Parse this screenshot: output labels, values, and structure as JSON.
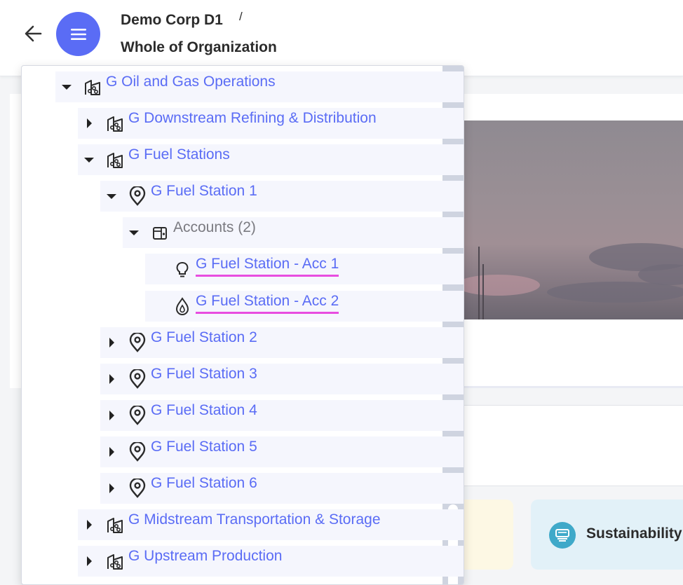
{
  "header": {
    "org_name": "Demo Corp D1",
    "separator": "/",
    "scope": "Whole of Organization"
  },
  "icons": {
    "back": "arrow-left-icon",
    "menu": "hamburger-menu-icon",
    "group": "building-group-icon",
    "site": "location-pin-icon",
    "accounts": "accounts-folder-icon",
    "electricity": "lightbulb-icon",
    "gas": "flame-drop-icon",
    "sustainability": "screen-stack-icon"
  },
  "colors": {
    "accent": "#5a6cf5",
    "link": "#5a6cf5",
    "highlight_underline": "#e84de0",
    "row_bg": "#f5f6fd"
  },
  "tree": [
    {
      "label": "G Oil and Gas Operations",
      "type": "group",
      "expanded": true
    },
    {
      "label": "G Downstream Refining & Distribution",
      "type": "group",
      "expanded": false
    },
    {
      "label": "G Fuel Stations",
      "type": "group",
      "expanded": true
    },
    {
      "label": "G Fuel Station 1",
      "type": "site",
      "expanded": true
    },
    {
      "label": "Accounts (2)",
      "type": "accounts",
      "expanded": true
    },
    {
      "label": "G Fuel Station - Acc 1",
      "type": "electricity"
    },
    {
      "label": "G Fuel Station - Acc 2",
      "type": "gas"
    },
    {
      "label": "G Fuel Station 2",
      "type": "site",
      "expanded": false
    },
    {
      "label": "G Fuel Station 3",
      "type": "site",
      "expanded": false
    },
    {
      "label": "G Fuel Station 4",
      "type": "site",
      "expanded": false
    },
    {
      "label": "G Fuel Station 5",
      "type": "site",
      "expanded": false
    },
    {
      "label": "G Fuel Station 6",
      "type": "site",
      "expanded": false
    },
    {
      "label": "G Midstream Transportation & Storage",
      "type": "group",
      "expanded": false
    },
    {
      "label": "G Upstream Production",
      "type": "group",
      "expanded": false
    }
  ],
  "cards": {
    "sustainability_label": "Sustainability"
  }
}
